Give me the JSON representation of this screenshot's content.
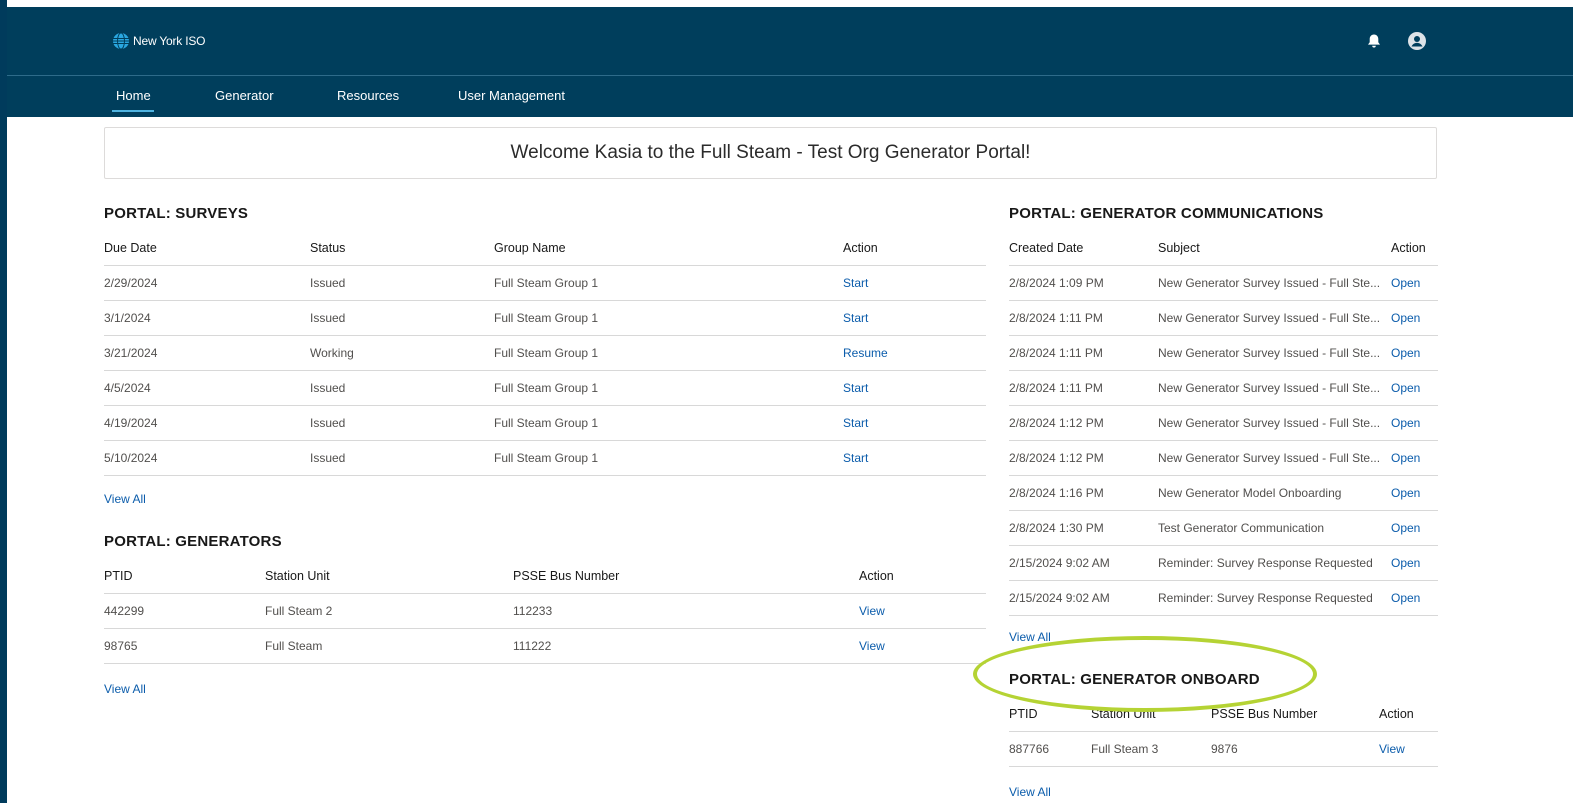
{
  "header": {
    "logo_text": "New York ISO",
    "bell_icon": "bell-icon",
    "avatar_icon": "user-avatar-icon"
  },
  "nav": {
    "items": [
      {
        "label": "Home",
        "active": true
      },
      {
        "label": "Generator"
      },
      {
        "label": "Resources"
      },
      {
        "label": "User Management"
      }
    ]
  },
  "welcome": {
    "text": "Welcome Kasia to the Full Steam - Test Org Generator Portal!"
  },
  "surveys": {
    "title": "PORTAL: SURVEYS",
    "columns": [
      "Due Date",
      "Status",
      "Group Name",
      "Action"
    ],
    "rows": [
      [
        "2/29/2024",
        "Issued",
        "Full Steam Group 1",
        "Start"
      ],
      [
        "3/1/2024",
        "Issued",
        "Full Steam Group 1",
        "Start"
      ],
      [
        "3/21/2024",
        "Working",
        "Full Steam Group 1",
        "Resume"
      ],
      [
        "4/5/2024",
        "Issued",
        "Full Steam Group 1",
        "Start"
      ],
      [
        "4/19/2024",
        "Issued",
        "Full Steam Group 1",
        "Start"
      ],
      [
        "5/10/2024",
        "Issued",
        "Full Steam Group 1",
        "Start"
      ]
    ],
    "view_all": "View All"
  },
  "generators": {
    "title": "PORTAL: GENERATORS",
    "columns": [
      "PTID",
      "Station Unit",
      "PSSE Bus Number",
      "Action"
    ],
    "rows": [
      [
        "442299",
        "Full Steam 2",
        "112233",
        "View"
      ],
      [
        "98765",
        "Full Steam",
        "111222",
        "View"
      ]
    ],
    "view_all": "View All"
  },
  "communications": {
    "title": "PORTAL: GENERATOR COMMUNICATIONS",
    "columns": [
      "Created Date",
      "Subject",
      "Action"
    ],
    "rows": [
      [
        "2/8/2024 1:09 PM",
        "New Generator Survey Issued - Full Ste...",
        "Open"
      ],
      [
        "2/8/2024 1:11 PM",
        "New Generator Survey Issued - Full Ste...",
        "Open"
      ],
      [
        "2/8/2024 1:11 PM",
        "New Generator Survey Issued - Full Ste...",
        "Open"
      ],
      [
        "2/8/2024 1:11 PM",
        "New Generator Survey Issued - Full Ste...",
        "Open"
      ],
      [
        "2/8/2024 1:12 PM",
        "New Generator Survey Issued - Full Ste...",
        "Open"
      ],
      [
        "2/8/2024 1:12 PM",
        "New Generator Survey Issued - Full Ste...",
        "Open"
      ],
      [
        "2/8/2024 1:16 PM",
        "New Generator Model Onboarding",
        "Open"
      ],
      [
        "2/8/2024 1:30 PM",
        "Test Generator Communication",
        "Open"
      ],
      [
        "2/15/2024 9:02 AM",
        "Reminder: Survey Response Requested",
        "Open"
      ],
      [
        "2/15/2024 9:02 AM",
        "Reminder: Survey Response Requested",
        "Open"
      ]
    ],
    "view_all": "View All"
  },
  "onboard": {
    "title": "PORTAL: GENERATOR ONBOARD",
    "columns": [
      "PTID",
      "Station Unit",
      "PSSE Bus Number",
      "Action"
    ],
    "rows": [
      [
        "887766",
        "Full Steam 3",
        "9876",
        "View"
      ]
    ],
    "view_all": "View All"
  },
  "colors": {
    "header_bg": "#003e5c",
    "link": "#0b5cab",
    "highlight_ring": "#b5d334"
  }
}
